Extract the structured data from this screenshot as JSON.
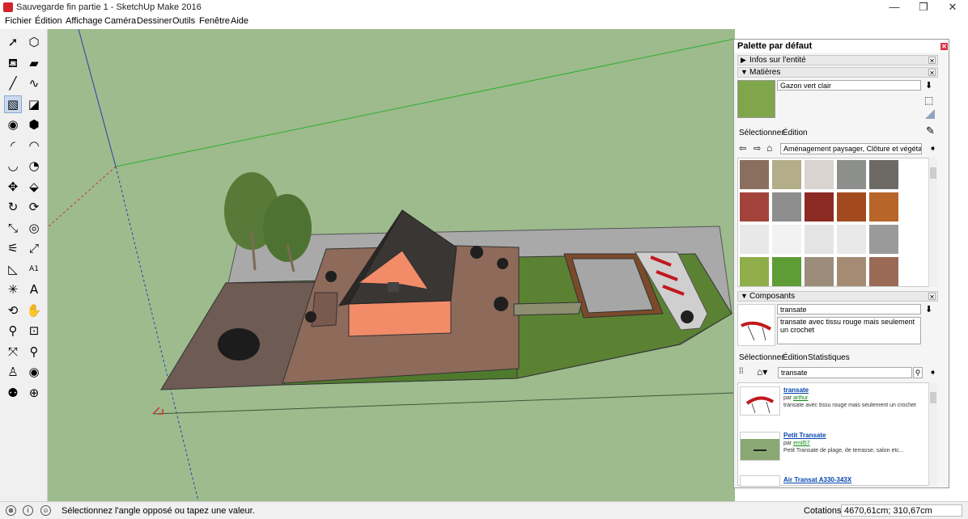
{
  "window": {
    "title": "Sauvegarde fin partie 1 - SketchUp Make 2016",
    "minimize": "—",
    "maximize": "❐",
    "close": "✕"
  },
  "menu": [
    "Fichier",
    "Édition",
    "Affichage",
    "Caméra",
    "Dessiner",
    "Outils",
    "Fenêtre",
    "Aide"
  ],
  "tools": [
    {
      "name": "select-icon",
      "glyph": "➚"
    },
    {
      "name": "make-component-icon",
      "glyph": "⬡"
    },
    {
      "name": "paint-bucket-icon",
      "glyph": "⛾"
    },
    {
      "name": "eraser-icon",
      "glyph": "▰"
    },
    {
      "name": "line-icon",
      "glyph": "╱"
    },
    {
      "name": "freehand-icon",
      "glyph": "∿"
    },
    {
      "name": "rectangle-icon",
      "glyph": "▧",
      "active": true
    },
    {
      "name": "rotated-rectangle-icon",
      "glyph": "◪"
    },
    {
      "name": "circle-icon",
      "glyph": "◉"
    },
    {
      "name": "polygon-icon",
      "glyph": "⬢"
    },
    {
      "name": "arc-icon",
      "glyph": "◜"
    },
    {
      "name": "two-point-arc-icon",
      "glyph": "◠"
    },
    {
      "name": "three-point-arc-icon",
      "glyph": "◡"
    },
    {
      "name": "pie-icon",
      "glyph": "◔"
    },
    {
      "name": "move-icon",
      "glyph": "✥"
    },
    {
      "name": "push-pull-icon",
      "glyph": "⬙"
    },
    {
      "name": "rotate-icon",
      "glyph": "↻"
    },
    {
      "name": "follow-me-icon",
      "glyph": "⟳"
    },
    {
      "name": "scale-icon",
      "glyph": "⤡"
    },
    {
      "name": "offset-icon",
      "glyph": "◎"
    },
    {
      "name": "tape-measure-icon",
      "glyph": "⚟"
    },
    {
      "name": "dimension-icon",
      "glyph": "⤢"
    },
    {
      "name": "protractor-icon",
      "glyph": "◺"
    },
    {
      "name": "text-icon",
      "glyph": "A1"
    },
    {
      "name": "axes-icon",
      "glyph": "✳"
    },
    {
      "name": "3d-text-icon",
      "glyph": "A"
    },
    {
      "name": "orbit-icon",
      "glyph": "⟲"
    },
    {
      "name": "pan-icon",
      "glyph": "✋"
    },
    {
      "name": "zoom-icon",
      "glyph": "⚲"
    },
    {
      "name": "zoom-window-icon",
      "glyph": "⊡"
    },
    {
      "name": "zoom-extents-icon",
      "glyph": "⤧"
    },
    {
      "name": "previous-view-icon",
      "glyph": "⚲"
    },
    {
      "name": "position-camera-icon",
      "glyph": "♙"
    },
    {
      "name": "look-around-icon",
      "glyph": "◉"
    },
    {
      "name": "walk-icon",
      "glyph": "⚉"
    },
    {
      "name": "section-plane-icon",
      "glyph": "⊕"
    }
  ],
  "palette": {
    "title": "Palette par défaut",
    "entity_info": "Infos sur l'entité",
    "materials": {
      "header": "Matières",
      "name_value": "Gazon vert clair",
      "tab_select": "Sélectionner",
      "tab_edit": "Édition",
      "collection": "Aménagement paysager, Clôture et végétation",
      "swatches": [
        "#8a6e5e",
        "#b3ad8a",
        "#d9d4cf",
        "#8d8f8c",
        "#6d6a66",
        "#a2443c",
        "#8e8e8e",
        "#8c2a24",
        "#a24a1e",
        "#b8652a",
        "#e8e8e8",
        "#f2f2f2",
        "#e4e4e4",
        "#e9e9e9",
        "#9a9a9a",
        "#8fad48",
        "#5e9c36",
        "#9c8c7a",
        "#a58a74",
        "#9a6a56"
      ]
    },
    "components": {
      "header": "Composants",
      "name_value": "transate",
      "desc_value": "transate avec tissu rouge mais seulement un crochet",
      "tab_select": "Sélectionner",
      "tab_edit": "Édition",
      "tab_stats": "Statistiques",
      "search_value": "transate",
      "results": [
        {
          "title": "transate",
          "by": "par",
          "author": "arthur",
          "desc": "transate avec tissu rouge mais seulement un crochet"
        },
        {
          "title": "Petit Transate",
          "by": "par",
          "author": "emil57",
          "desc": "Petit Transate de plage, de terrasse, salon etc..."
        },
        {
          "title": "Air Transat A330-343X",
          "by": "",
          "author": "",
          "desc": ""
        }
      ]
    }
  },
  "status": {
    "message": "Sélectionnez l'angle opposé ou tapez une valeur.",
    "coords_label": "Cotations",
    "coords_value": "4670,61cm; 310,67cm"
  },
  "colors": {
    "sky_ground": "#9dbb8d",
    "accent": "#d3242b"
  }
}
